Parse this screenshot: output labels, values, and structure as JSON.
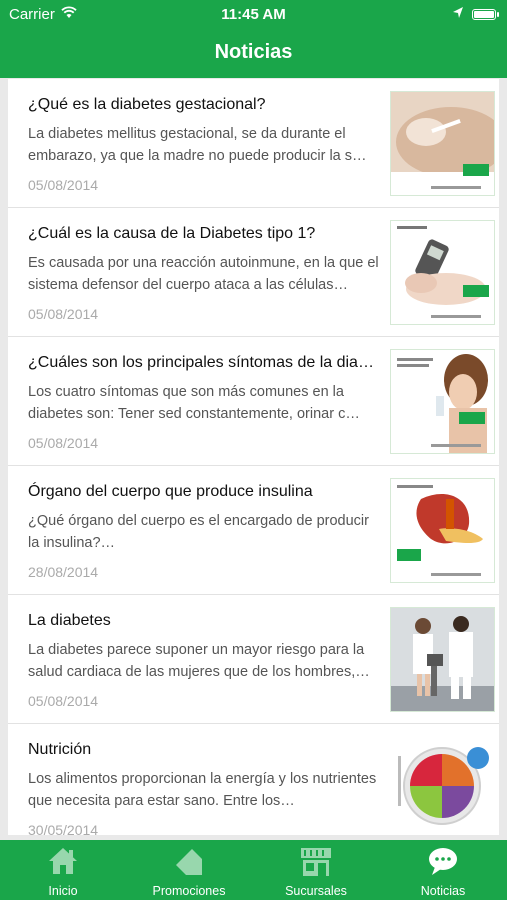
{
  "status": {
    "carrier": "Carrier",
    "time": "11:45 AM"
  },
  "nav": {
    "title": "Noticias"
  },
  "news": [
    {
      "title": "¿Qué es la diabetes gestacional?",
      "desc": "La diabetes mellitus gestacional, se da durante el embarazo, ya que la madre no puede producir la s…",
      "date": "05/08/2014"
    },
    {
      "title": "¿Cuál es la causa de la Diabetes tipo 1?",
      "desc": "Es causada por una reacción autoinmune, en la que el sistema defensor del cuerpo ataca a las células…",
      "date": "05/08/2014"
    },
    {
      "title": "¿Cuáles son los principales síntomas de la dia…",
      "desc": "Los cuatro síntomas que son más comunes en la diabetes son: Tener sed constantemente, orinar c…",
      "date": "05/08/2014"
    },
    {
      "title": "Órgano del cuerpo que produce  insulina",
      "desc": " ¿Qué órgano del cuerpo es el encargado de producir la insulina?…",
      "date": "28/08/2014"
    },
    {
      "title": "La diabetes",
      "desc": "La diabetes parece suponer un mayor riesgo para la salud cardiaca de las mujeres que de los hombres,…",
      "date": "05/08/2014"
    },
    {
      "title": "Nutrición",
      "desc": "Los alimentos proporcionan la energía y los nutrientes que necesita para estar sano. Entre los…",
      "date": "30/05/2014"
    }
  ],
  "tabs": [
    {
      "label": "Inicio",
      "icon": "home-icon"
    },
    {
      "label": "Promociones",
      "icon": "tag-icon"
    },
    {
      "label": "Sucursales",
      "icon": "store-icon"
    },
    {
      "label": "Noticias",
      "icon": "chat-bubble-icon"
    }
  ],
  "colors": {
    "brand": "#1aa64a"
  }
}
